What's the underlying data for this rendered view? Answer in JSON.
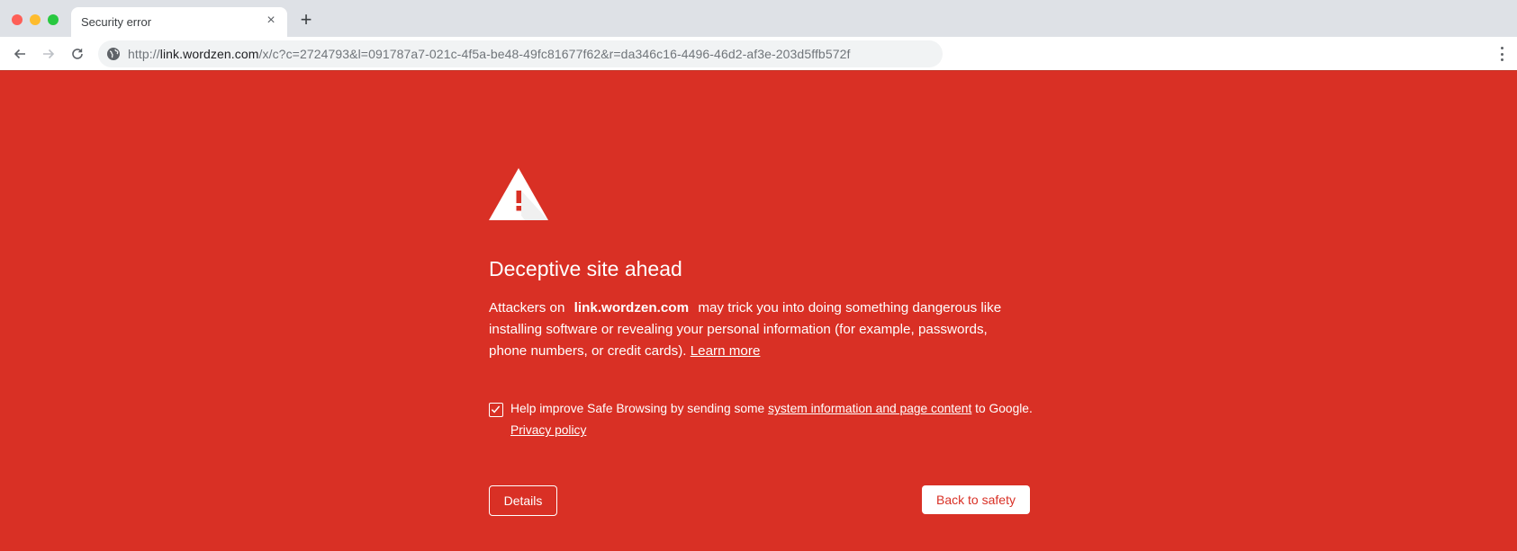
{
  "window": {
    "tab": {
      "title": "Security error",
      "close_label": "×"
    },
    "new_tab_label": "+"
  },
  "toolbar": {
    "url_scheme": "http://",
    "url_host": "link.wordzen.com",
    "url_path": "/x/c?c=2724793&l=091787a7-021c-4f5a-be48-49fc81677f62&r=da346c16-4496-46d2-af3e-203d5ffb572f"
  },
  "interstitial": {
    "background_color": "#d93025",
    "heading": "Deceptive site ahead",
    "explanation_prefix": "Attackers on",
    "explanation_domain": "link.wordzen.com",
    "explanation_suffix": "may trick you into doing something dangerous like installing software or revealing your personal information (for example, passwords, phone numbers, or credit cards).",
    "learn_more": "Learn more",
    "optin": {
      "checked": true,
      "text_prefix": "Help improve Safe Browsing by sending some",
      "link_text": "system information and page content",
      "text_suffix": "to Google.",
      "privacy_link": "Privacy policy"
    },
    "details_button": "Details",
    "back_button": "Back to safety"
  }
}
